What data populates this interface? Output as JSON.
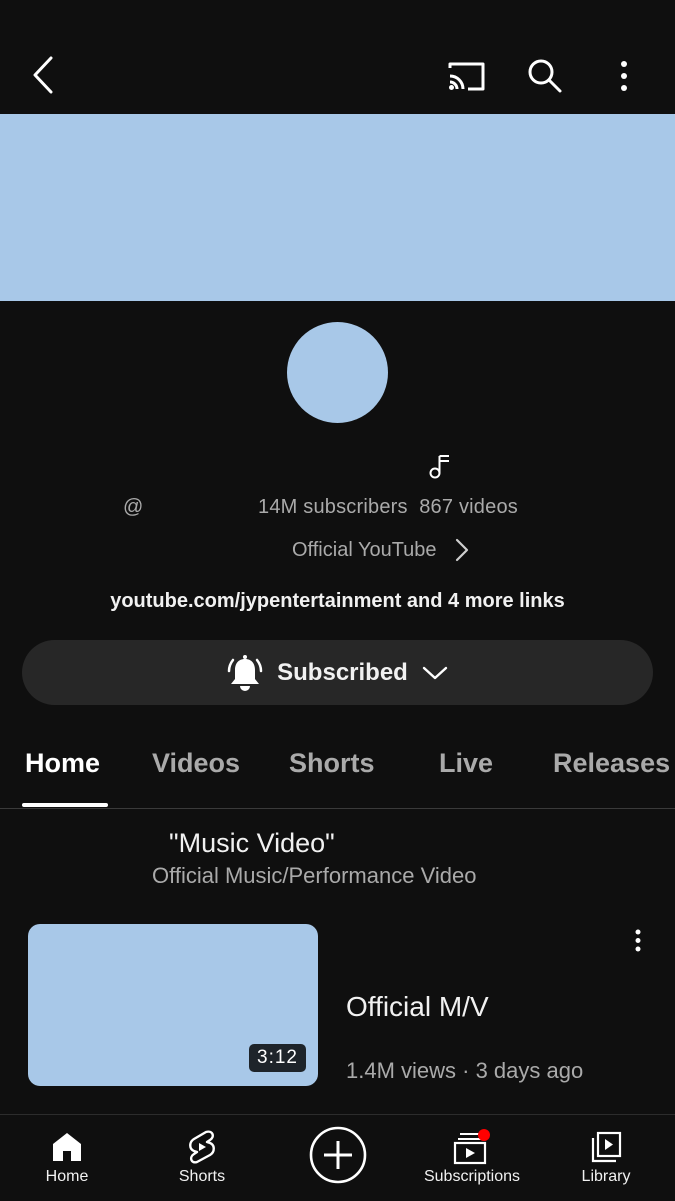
{
  "channel": {
    "handle_prefix": "@",
    "subscribers": "14M subscribers",
    "videos": "867 videos",
    "description": "Official YouTube",
    "links_text": "youtube.com/jypentertainment and 4 more links"
  },
  "subscribe_button": {
    "label": "Subscribed"
  },
  "tabs": [
    {
      "label": "Home",
      "active": true
    },
    {
      "label": "Videos"
    },
    {
      "label": "Shorts"
    },
    {
      "label": "Live"
    },
    {
      "label": "Releases"
    }
  ],
  "section": {
    "title": "\"Music Video\"",
    "subtitle": "Official Music/Performance Video"
  },
  "video": {
    "title": "Official M/V",
    "duration": "3:12",
    "meta": "1.4M views · 3 days ago"
  },
  "bottom_nav": [
    {
      "label": "Home",
      "icon": "home-icon"
    },
    {
      "label": "Shorts",
      "icon": "shorts-icon"
    },
    {
      "label": "",
      "icon": "create-icon"
    },
    {
      "label": "Subscriptions",
      "icon": "subscriptions-icon",
      "notification_dot": true
    },
    {
      "label": "Library",
      "icon": "library-icon"
    }
  ],
  "colors": {
    "background": "#0f0f0f",
    "placeholder_blue": "#a8c8e8",
    "button_bg": "#272727",
    "secondary_text": "#aaaaaa",
    "notification_red": "#ff0000"
  }
}
